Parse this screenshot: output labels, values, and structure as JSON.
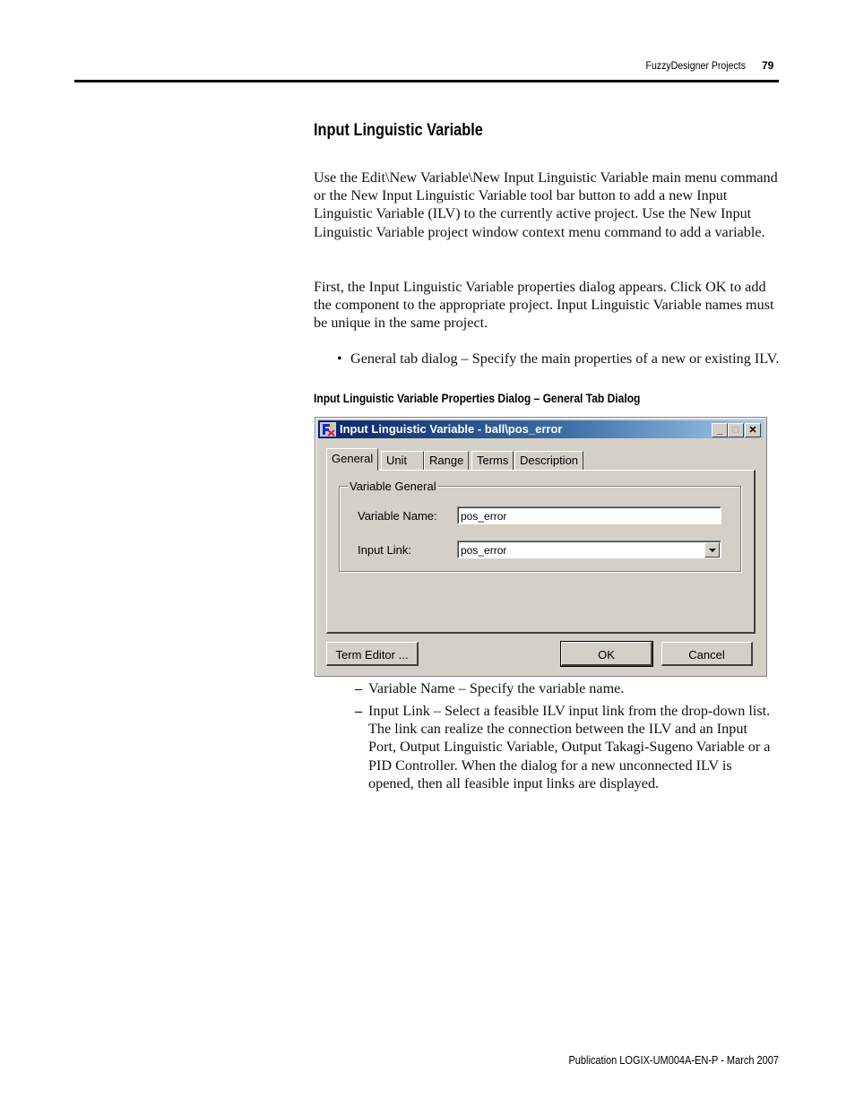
{
  "header": {
    "section_title": "FuzzyDesigner Projects",
    "page_number": "79"
  },
  "heading": "Input Linguistic Variable",
  "paragraphs": [
    "Use the Edit\\New Variable\\New Input Linguistic Variable main menu command or the New Input Linguistic Variable tool bar button to add a new Input Linguistic Variable (ILV) to the currently active project. Use the New Input Linguistic Variable project window context menu command to add a variable.",
    "First, the Input Linguistic Variable properties dialog appears. Click OK to add the component to the appropriate project. Input Linguistic Variable names must be unique in the same project."
  ],
  "bullet": {
    "symbol": "•",
    "text": "General tab dialog – Specify the main properties of a new or existing ILV."
  },
  "figure_caption": "Input Linguistic Variable Properties Dialog – General Tab Dialog",
  "dialog": {
    "title": "Input Linguistic Variable - ball\\pos_error",
    "icon": "fuzzy-app-icon",
    "title_buttons": {
      "minimize": "_",
      "maximize": "□",
      "close": "✕"
    },
    "tabs": [
      {
        "label": "General",
        "active": true
      },
      {
        "label": "Unit",
        "active": false
      },
      {
        "label": "Range",
        "active": false
      },
      {
        "label": "Terms",
        "active": false
      },
      {
        "label": "Description",
        "active": false
      }
    ],
    "group_title": "Variable General",
    "fields": {
      "variable_name": {
        "label": "Variable Name:",
        "value": "pos_error"
      },
      "input_link": {
        "label": "Input Link:",
        "value": "pos_error"
      }
    },
    "buttons": {
      "term_editor": "Term Editor ...",
      "ok": "OK",
      "cancel": "Cancel"
    }
  },
  "sub_items": [
    {
      "dash": "–",
      "text": "Variable Name – Specify the variable name."
    },
    {
      "dash": "–",
      "text": "Input Link – Select a feasible ILV input link from the drop-down list. The link can realize the connection between the ILV and an Input Port, Output Linguistic Variable, Output Takagi-Sugeno Variable or a PID Controller. When the dialog for a new unconnected ILV is opened, then all feasible input links are displayed."
    }
  ],
  "footer": "Publication LOGIX-UM004A-EN-P - March 2007"
}
